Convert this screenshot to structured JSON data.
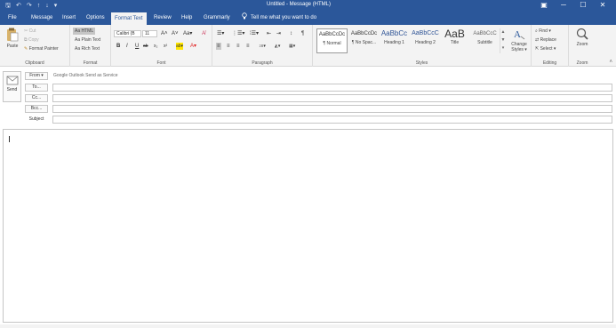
{
  "titlebar": {
    "title": "Untitled - Message (HTML)",
    "qat": {
      "save": "🖫",
      "undo": "↶",
      "redo": "↷",
      "up": "↑",
      "down": "↓",
      "more": "▾"
    },
    "window_controls": {
      "ribbon_options": "▣",
      "minimize": "─",
      "maximize": "☐",
      "close": "✕"
    }
  },
  "tabs": [
    {
      "label": "File"
    },
    {
      "label": "Message"
    },
    {
      "label": "Insert"
    },
    {
      "label": "Options"
    },
    {
      "label": "Format Text"
    },
    {
      "label": "Review"
    },
    {
      "label": "Help"
    },
    {
      "label": "Grammarly"
    }
  ],
  "tell_me": "Tell me what you want to do",
  "ribbon": {
    "clipboard": {
      "label": "Clipboard",
      "paste": "Paste",
      "cut": "Cut",
      "copy": "Copy",
      "format_painter": "Format Painter"
    },
    "format": {
      "label": "Format",
      "html": "Aa HTML",
      "plain": "Aa Plain Text",
      "rich": "Aa Rich Text"
    },
    "font": {
      "label": "Font",
      "font_name": "Calibri (B",
      "font_size": "11",
      "grow": "A˄",
      "shrink": "A˅",
      "case": "Aa▾",
      "clear": "A̸",
      "bold": "B",
      "italic": "I",
      "underline": "U",
      "strike": "ab",
      "subscript": "x₂",
      "superscript": "x²",
      "highlight": "ab▾",
      "font_color": "A▾"
    },
    "paragraph": {
      "label": "Paragraph",
      "bullets": "☰▾",
      "numbering": "⋮☰▾",
      "multilevel": "⁞☰▾",
      "decrease_indent": "⇤",
      "increase_indent": "⇥",
      "sort": "↕",
      "show_marks": "¶",
      "align_left": "≡",
      "align_center": "≡",
      "align_right": "≡",
      "justify": "≡",
      "line_spacing": "↕≡▾",
      "shading": "◭▾",
      "borders": "▦▾"
    },
    "styles": {
      "label": "Styles",
      "items": [
        {
          "preview": "AaBbCcDc",
          "name": "¶ Normal"
        },
        {
          "preview": "AaBbCcDc",
          "name": "¶ No Spac..."
        },
        {
          "preview": "AaBbCc",
          "name": "Heading 1"
        },
        {
          "preview": "AaBbCcC",
          "name": "Heading 2"
        },
        {
          "preview": "AaB",
          "name": "Title"
        },
        {
          "preview": "AaBbCcC",
          "name": "Subtitle"
        }
      ],
      "change_styles": "Change Styles ▾"
    },
    "editing": {
      "label": "Editing",
      "find": "Find ▾",
      "replace": "Replace",
      "select": "Select ▾"
    },
    "zoom": {
      "label": "Zoom",
      "zoom": "Zoom"
    }
  },
  "compose": {
    "send": "Send",
    "from_btn": "From ▾",
    "from_value": "Google Outlook Send as Service",
    "to_btn": "To...",
    "cc_btn": "Cc...",
    "bcc_btn": "Bcc...",
    "subject_label": "Subject"
  },
  "colors": {
    "accent": "#2b579a",
    "ribbon_bg": "#f3f3f3",
    "heading_blue": "#2f5496",
    "font_color_red": "#e02020",
    "highlight_yellow": "#ffe600"
  }
}
